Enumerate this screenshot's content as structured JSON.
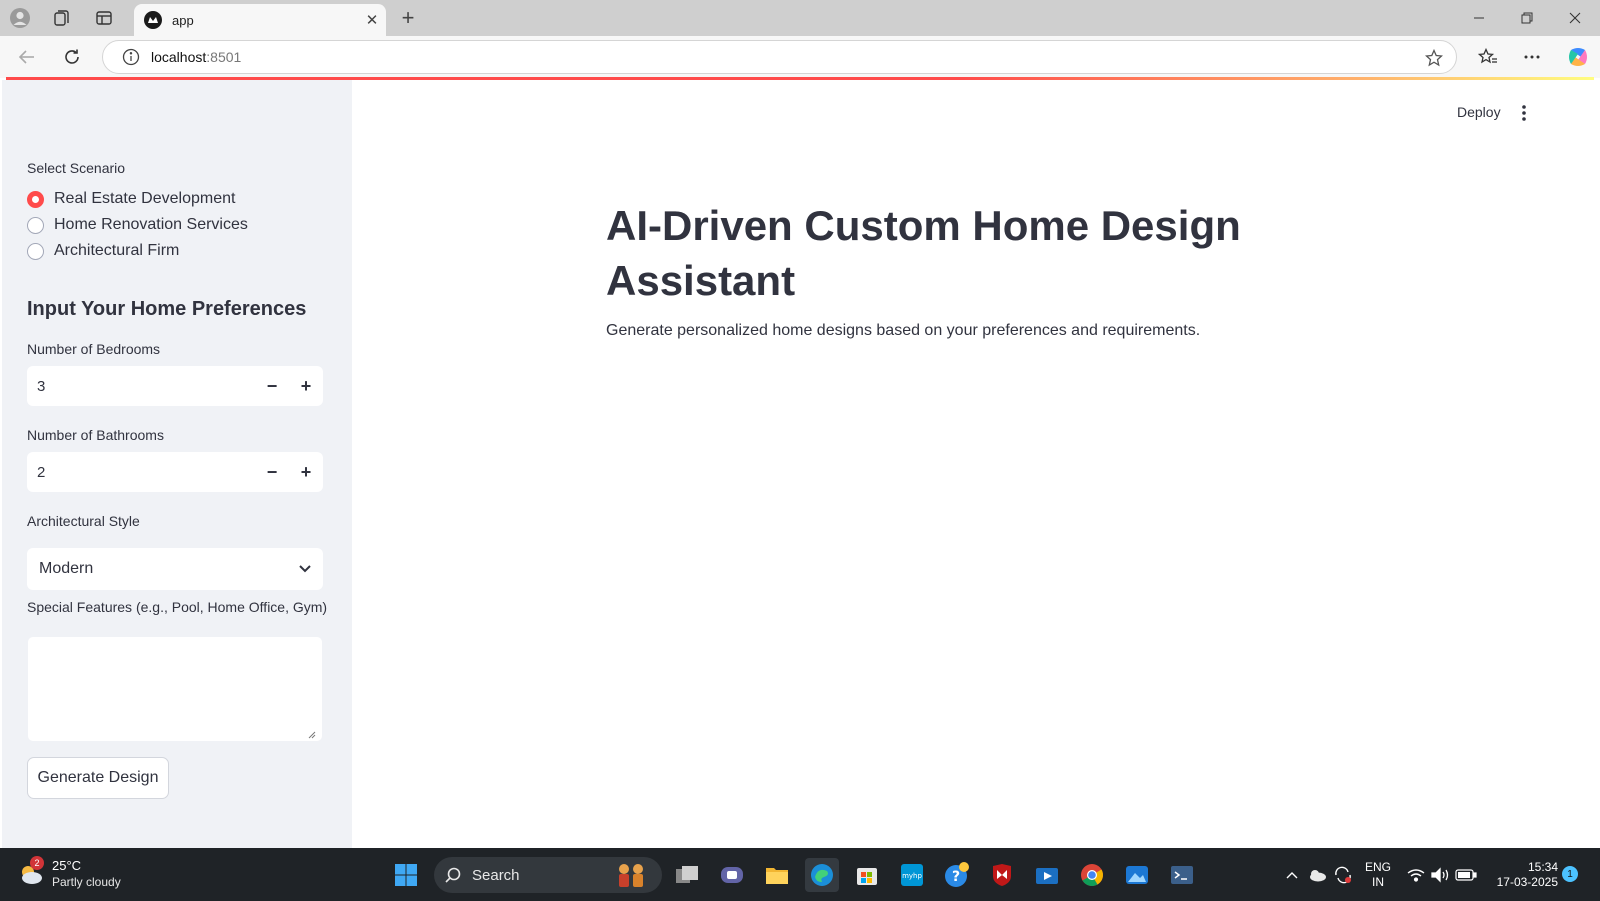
{
  "browser": {
    "tab_title": "app",
    "url_host": "localhost",
    "url_port": ":8501"
  },
  "sidebar": {
    "scenario_label": "Select Scenario",
    "scenarios": [
      {
        "label": "Real Estate Development",
        "checked": true
      },
      {
        "label": "Home Renovation Services",
        "checked": false
      },
      {
        "label": "Architectural Firm",
        "checked": false
      }
    ],
    "preferences_heading": "Input Your Home Preferences",
    "bedrooms_label": "Number of Bedrooms",
    "bedrooms_value": "3",
    "bathrooms_label": "Number of Bathrooms",
    "bathrooms_value": "2",
    "style_label": "Architectural Style",
    "style_value": "Modern",
    "features_label": "Special Features (e.g., Pool, Home Office, Gym)",
    "features_value": "",
    "generate_button": "Generate Design"
  },
  "main": {
    "deploy_label": "Deploy",
    "title": "AI-Driven Custom Home Design Assistant",
    "description": "Generate personalized home designs based on your preferences and requirements."
  },
  "taskbar": {
    "weather_badge": "2",
    "weather_temp": "25°C",
    "weather_condition": "Partly cloudy",
    "search_label": "Search",
    "lang_top": "ENG",
    "lang_bottom": "IN",
    "time": "15:34",
    "date": "17-03-2025",
    "notification_count": "1"
  },
  "colors": {
    "accent": "#ff4b4b",
    "sidebar_bg": "#f0f2f6",
    "text": "#31333f",
    "taskbar_bg": "#1f2327"
  }
}
